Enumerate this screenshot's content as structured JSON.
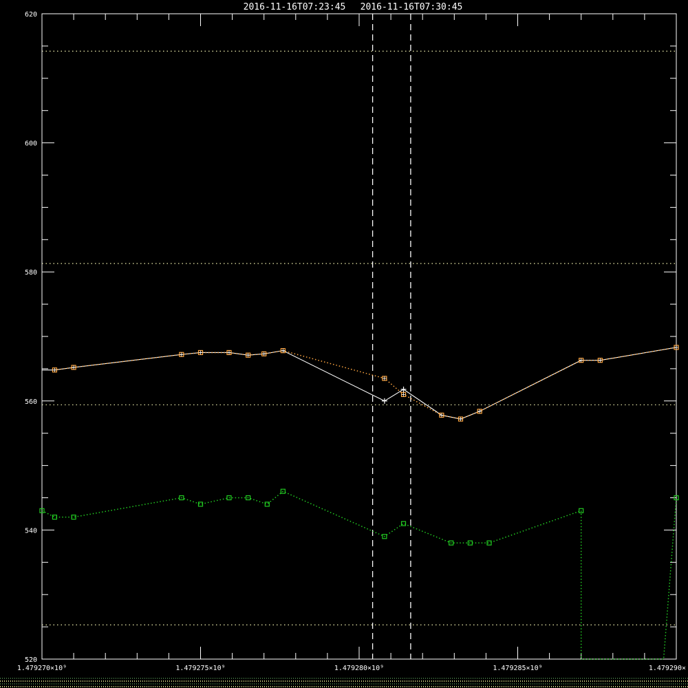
{
  "header": {
    "left_time": "2016-11-16T07:23:45",
    "right_time": "2016-11-16T07:30:45"
  },
  "chart_data": {
    "type": "line",
    "xlim": [
      1479270000,
      1479290000
    ],
    "ylim": [
      520,
      620
    ],
    "x_ticks": [
      {
        "value": 1479270000,
        "label": "1.479270×10⁹"
      },
      {
        "value": 1479275000,
        "label": "1.479275×10⁹"
      },
      {
        "value": 1479280000,
        "label": "1.479280×10⁹"
      },
      {
        "value": 1479285000,
        "label": "1.479285×10⁹"
      },
      {
        "value": 1479290000,
        "label": "1.479290×"
      }
    ],
    "y_ticks": [
      {
        "value": 520,
        "label": "520"
      },
      {
        "value": 540,
        "label": "540"
      },
      {
        "value": 560,
        "label": "560"
      },
      {
        "value": 580,
        "label": "580"
      },
      {
        "value": 600,
        "label": "600"
      },
      {
        "value": 620,
        "label": "620"
      }
    ],
    "y_minor_step": 5,
    "x_minor_step": 1000,
    "horizontal_dotted_levels": [
      525.3,
      559.4,
      581.3,
      614.2
    ],
    "vertical_dashed_markers": [
      1479280425,
      1479281625
    ],
    "series": [
      {
        "color": "#ffffff",
        "style": "solid",
        "x": [
          1479270000,
          1479270400,
          1479271000,
          1479274400,
          1479275000,
          1479275900,
          1479276500,
          1479277000,
          1479277600,
          1479280800,
          1479281400,
          1479282600,
          1479283200,
          1479283800,
          1479287000,
          1479287600,
          1479290000
        ],
        "y": [
          564.8,
          564.8,
          565.2,
          567.2,
          567.5,
          567.5,
          567.1,
          567.3,
          567.8,
          560.0,
          561.8,
          557.8,
          557.2,
          558.4,
          566.3,
          566.3,
          568.3
        ]
      },
      {
        "color": "#ffa640",
        "style": "dotted",
        "marker": "square",
        "x": [
          1479270400,
          1479271000,
          1479274400,
          1479275000,
          1479275900,
          1479276500,
          1479277000,
          1479277600,
          1479280800,
          1479281400,
          1479282600,
          1479283200,
          1479283800,
          1479287000,
          1479287600,
          1479290000
        ],
        "y": [
          564.8,
          565.2,
          567.2,
          567.5,
          567.5,
          567.1,
          567.3,
          567.8,
          563.5,
          561.0,
          557.8,
          557.2,
          558.4,
          566.3,
          566.3,
          568.3
        ]
      },
      {
        "color": "#22cc22",
        "style": "dotted",
        "marker": "square",
        "x": [
          1479270000,
          1479270400,
          1479271000,
          1479274400,
          1479275000,
          1479275900,
          1479276500,
          1479277100,
          1479277600,
          1479280800,
          1479281400,
          1479282900,
          1479283500,
          1479284100,
          1479287000,
          1479287000,
          1479289600,
          1479290000
        ],
        "y": [
          543.0,
          542.0,
          542.0,
          545.0,
          544.0,
          545.0,
          545.0,
          544.0,
          546.0,
          539.0,
          541.0,
          538.0,
          538.0,
          538.0,
          543.0,
          520.0,
          520.0,
          545.0
        ]
      }
    ],
    "white_cross_points": [
      {
        "x": 1479280800,
        "y": 560.0
      },
      {
        "x": 1479281400,
        "y": 561.8
      }
    ]
  }
}
